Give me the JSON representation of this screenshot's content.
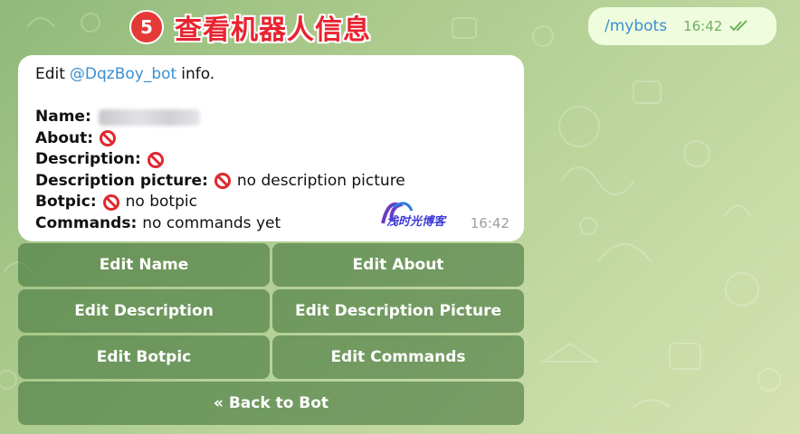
{
  "annotation": {
    "step_number": "5",
    "title": "查看机器人信息"
  },
  "outgoing": {
    "text": "/mybots",
    "time": "16:42"
  },
  "incoming": {
    "intro_prefix": "Edit",
    "bot_handle": "@DqzBoy_bot",
    "intro_suffix": "info.",
    "name_label": "Name:",
    "about_label": "About:",
    "description_label": "Description:",
    "desc_picture_label": "Description picture:",
    "desc_picture_value": "no description picture",
    "botpic_label": "Botpic:",
    "botpic_value": "no botpic",
    "commands_label": "Commands:",
    "commands_value": "no commands yet",
    "time": "16:42",
    "watermark_text": "浅时光博客"
  },
  "keyboard": {
    "edit_name": "Edit Name",
    "edit_about": "Edit About",
    "edit_description": "Edit Description",
    "edit_description_picture": "Edit Description Picture",
    "edit_botpic": "Edit Botpic",
    "edit_commands": "Edit Commands",
    "back_to_bot": "« Back to Bot"
  },
  "colors": {
    "accent_link": "#3a8fd0",
    "annotation_red": "#e53935",
    "out_bubble": "#effdde"
  }
}
